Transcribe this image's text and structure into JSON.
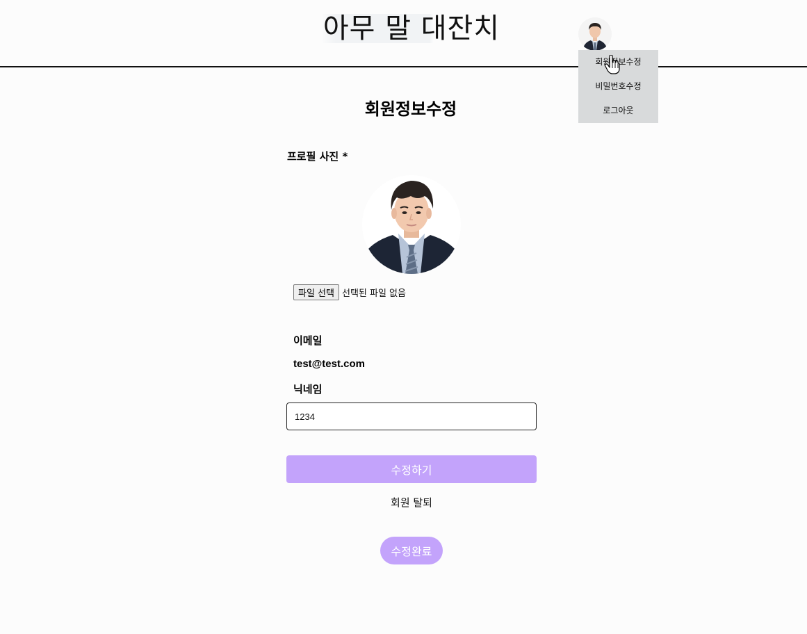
{
  "header": {
    "site_title": "아무 말 대잔치"
  },
  "dropdown": {
    "items": [
      "회원정보수정",
      "비밀번호수정",
      "로그아웃"
    ]
  },
  "main": {
    "page_title": "회원정보수정",
    "profile_label": "프로필 사진 *",
    "file_button_label": "파일 선택",
    "file_status": "선택된 파일 없음",
    "email_label": "이메일",
    "email_value": "test@test.com",
    "nickname_label": "닉네임",
    "nickname_value": "1234",
    "submit_label": "수정하기",
    "withdraw_label": "회원 탈퇴",
    "done_label": "수정완료"
  },
  "colors": {
    "accent": "#c3a3fb",
    "dropdown_bg": "#d8dadb"
  },
  "icons": {
    "avatar": "user-avatar-icon",
    "cursor": "hand-pointer-icon"
  }
}
